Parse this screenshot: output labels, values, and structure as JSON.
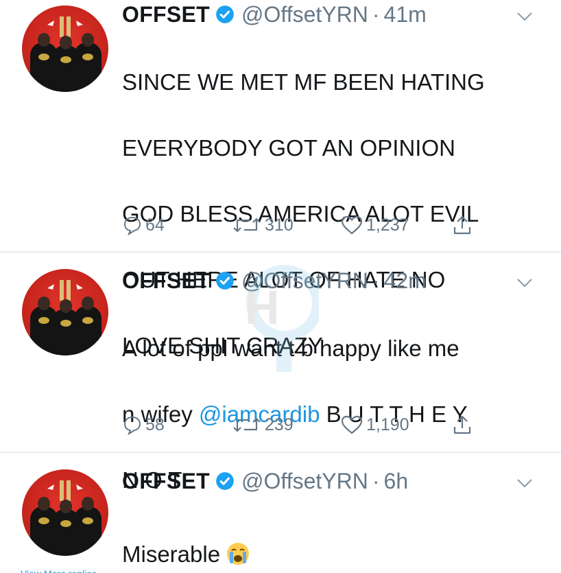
{
  "tweets": [
    {
      "name": "OFFSET",
      "handle": "@OffsetYRN",
      "separator": "·",
      "time": "41m",
      "lines": [
        "SINCE WE MET MF BEEN HATING",
        "EVERYBODY GOT AN OPINION",
        "GOD BLESS AMERICA ALOT EVIL",
        "OUT HERE ALOT OF HATE NO",
        "LOVE SHIT CRAZY"
      ],
      "replies": "64",
      "retweets": "310",
      "likes": "1,237"
    },
    {
      "name": "OFFSET",
      "handle": "@OffsetYRN",
      "separator": "·",
      "time": "42m",
      "line1": "A lot of ppl want t b happy like me",
      "line2_prefix": "n wifey ",
      "mention": "@iamcardib",
      "line2_suffix": " B U T T H E Y",
      "line3": "N O T",
      "replies": "58",
      "retweets": "239",
      "likes": "1,190"
    },
    {
      "name": "OFFSET",
      "handle": "@OffsetYRN",
      "separator": "·",
      "time": "6h",
      "text": "Miserable",
      "emoji": "crying-face-emoji"
    }
  ],
  "watermark": "H",
  "footer_partial": "View More replies",
  "colors": {
    "verified": "#1da1f2",
    "secondary": "#657786",
    "mention": "#1b95e0",
    "avatar": "#c8261e"
  }
}
